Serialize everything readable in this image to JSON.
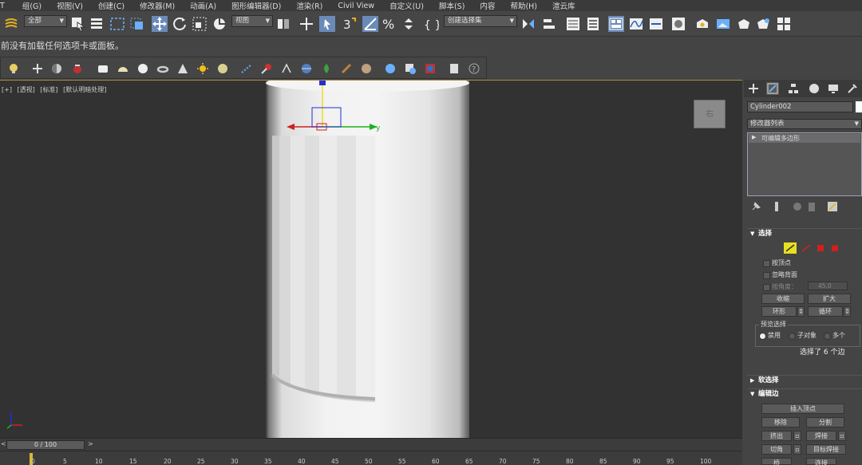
{
  "menubar": {
    "items": [
      "T",
      "组(G)",
      "视图(V)",
      "创建(C)",
      "修改器(M)",
      "动画(A)",
      "图形编辑器(D)",
      "渲染(R)",
      "Civil View",
      "自定义(U)",
      "脚本(S)",
      "内容",
      "帮助(H)",
      "渲云库"
    ]
  },
  "toolbar": {
    "selection_filter": "全部",
    "ref_coord": "视图",
    "named_selection": "创建选择集"
  },
  "status_message": "前没有加载任何选项卡或面板。",
  "viewport": {
    "labels": [
      "[+]",
      "[透视]",
      "[标准]",
      "[默认明暗处理]"
    ],
    "axis_y_label": "y",
    "viewcube_label": "右"
  },
  "timeline": {
    "frame_display": "0 / 100",
    "ticks": [
      "0",
      "5",
      "10",
      "15",
      "20",
      "25",
      "30",
      "35",
      "40",
      "45",
      "50",
      "55",
      "60",
      "65",
      "70",
      "75",
      "80",
      "85",
      "90",
      "95",
      "100"
    ]
  },
  "command_panel": {
    "object_name": "Cylinder002",
    "object_color": "#ffffff",
    "modifier_list_label": "修改器列表",
    "stack_item": "可编辑多边形",
    "selection_rollout": {
      "title": "选择",
      "by_vertex": "按顶点",
      "ignore_backfacing": "忽略背面",
      "by_angle": "按角度：",
      "angle_value": "45.0",
      "shrink": "收缩",
      "grow": "扩大",
      "ring": "环形",
      "loop": "循环",
      "preview_selection": "预览选择",
      "preview_disabled": "禁用",
      "preview_subobject": "子对象",
      "preview_multi": "多个",
      "status": "选择了 6 个边"
    },
    "soft_selection_title": "软选择",
    "edit_edges": {
      "title": "编辑边",
      "insert_vertex": "插入顶点",
      "remove": "移除",
      "split": "分割",
      "extrude": "挤出",
      "weld": "焊接",
      "chamfer": "切角",
      "target_weld": "目标焊接",
      "bridge": "桥",
      "connect": "连接"
    }
  },
  "colors": {
    "viewport_bg": "#323232",
    "accent_yellow": "#d8b838",
    "gizmo_red": "#d02020",
    "gizmo_green": "#20b020",
    "gizmo_blue": "#2030d0"
  }
}
